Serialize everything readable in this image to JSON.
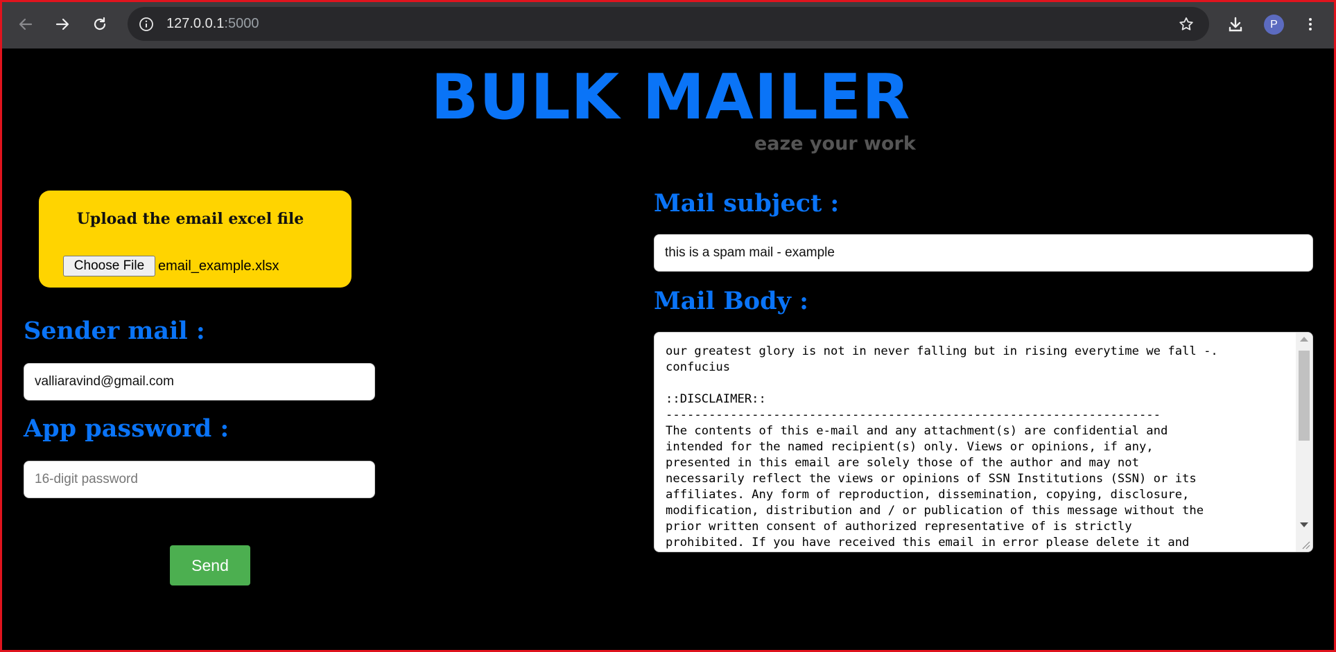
{
  "browser": {
    "url_host": "127.0.0.1",
    "url_port": ":5000",
    "profile_initial": "P"
  },
  "page": {
    "title": "BULK MAILER",
    "tagline": "eaze your work"
  },
  "upload": {
    "title": "Upload the email excel file",
    "button_label": "Choose File",
    "file_name": "email_example.xlsx"
  },
  "sender": {
    "label": "Sender mail :",
    "value": "valliaravind@gmail.com"
  },
  "password": {
    "label": "App password :",
    "placeholder": "16-digit password"
  },
  "send_label": "Send",
  "subject": {
    "label": "Mail subject :",
    "value": "this is a spam mail - example"
  },
  "body": {
    "label": "Mail Body :",
    "value": "our greatest glory is not in never falling but in rising everytime we fall -.\nconfucius\n\n::DISCLAIMER::\n---------------------------------------------------------------------\nThe contents of this e-mail and any attachment(s) are confidential and\nintended for the named recipient(s) only. Views or opinions, if any,\npresented in this email are solely those of the author and may not\nnecessarily reflect the views or opinions of SSN Institutions (SSN) or its\naffiliates. Any form of reproduction, dissemination, copying, disclosure,\nmodification, distribution and / or publication of this message without the\nprior written consent of authorized representative of is strictly\nprohibited. If you have received this email in error please delete it and"
  },
  "colors": {
    "accent": "#0a74f7",
    "upload_card": "#ffd400",
    "send_button": "#4caf50"
  }
}
